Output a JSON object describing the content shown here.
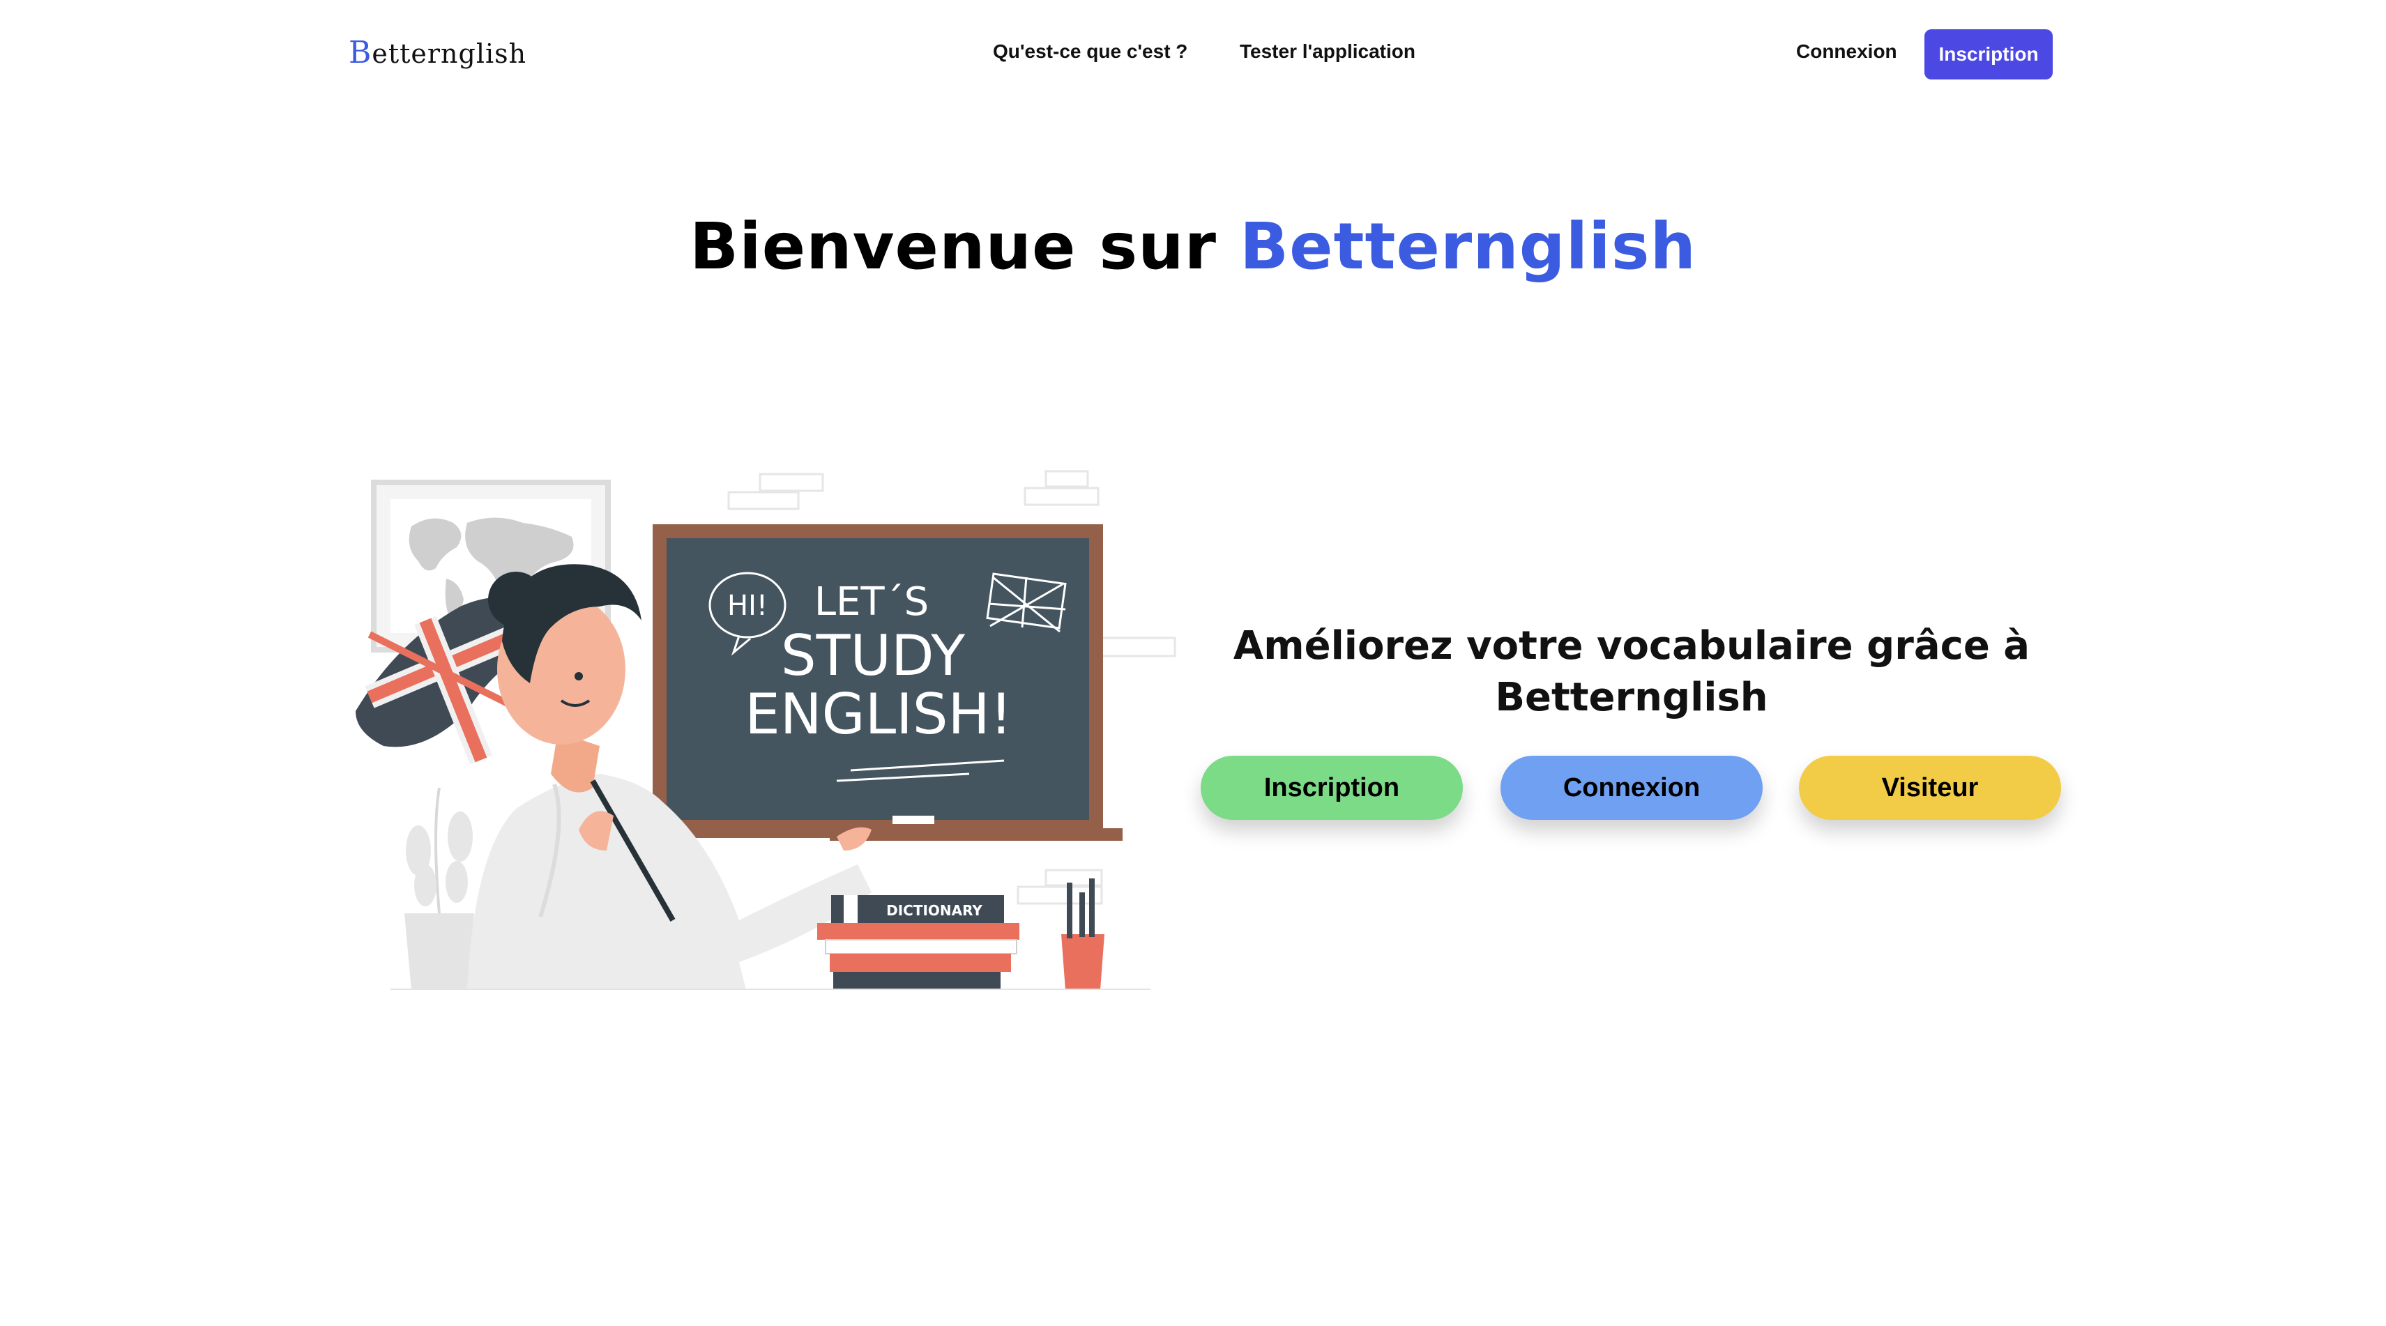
{
  "brand": {
    "first_letter": "B",
    "rest": "etternglish"
  },
  "nav": {
    "what_label": "Qu'est-ce que c'est ?",
    "test_label": "Tester l'application",
    "login_label": "Connexion",
    "signup_label": "Inscription"
  },
  "hero": {
    "title_prefix": "Bienvenue sur ",
    "title_brand": "Betternglish"
  },
  "illustration": {
    "bubble_text": "HI!",
    "board_line1": "LET´S",
    "board_line2": "STUDY",
    "board_line3": "ENGLISH!",
    "book_label": "DICTIONARY"
  },
  "panel": {
    "subtitle_line1": "Améliorez votre vocabulaire grâce à",
    "subtitle_line2": "Betternglish",
    "signup_label": "Inscription",
    "login_label": "Connexion",
    "visitor_label": "Visiteur"
  },
  "colors": {
    "accent": "#3b5be0",
    "nav_button": "#4b48e3",
    "signup_green": "#7bdb87",
    "login_blue": "#70a0f2",
    "visitor_yellow": "#f2cc47"
  }
}
